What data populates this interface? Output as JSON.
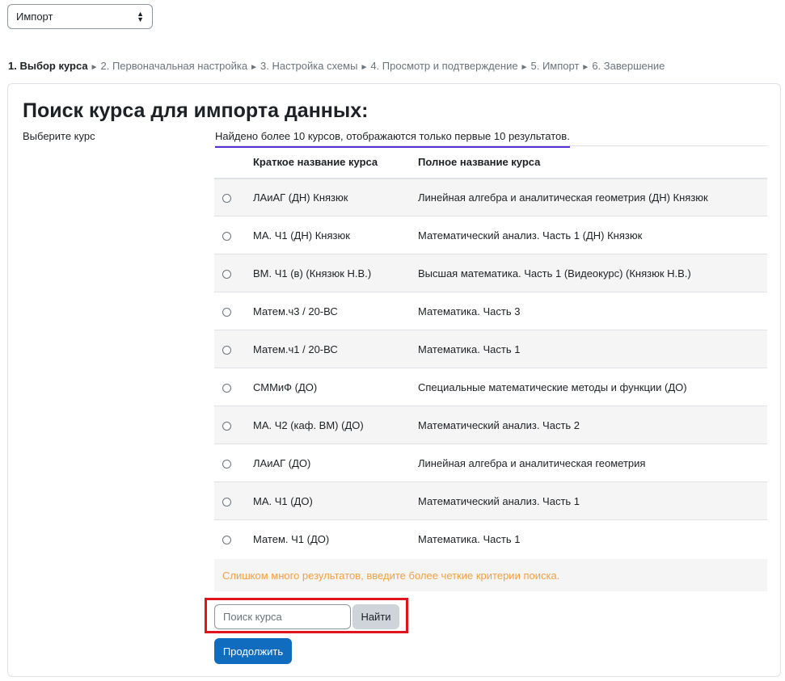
{
  "top_select": {
    "value": "Импорт"
  },
  "steps": [
    {
      "label": "1. Выбор курса",
      "current": true
    },
    {
      "label": "2. Первоначальная настройка",
      "current": false
    },
    {
      "label": "3. Настройка схемы",
      "current": false
    },
    {
      "label": "4. Просмотр и подтверждение",
      "current": false
    },
    {
      "label": "5. Импорт",
      "current": false
    },
    {
      "label": "6. Завершение",
      "current": false
    }
  ],
  "step_separator": "►",
  "panel": {
    "title": "Поиск курса для импорта данных:",
    "field_label": "Выберите курс",
    "found_note": "Найдено более 10 курсов, отображаются только первые 10 результатов.",
    "columns": {
      "short": "Краткое название курса",
      "full": "Полное название курса"
    },
    "rows": [
      {
        "short": "ЛАиАГ (ДН) Князюк",
        "full": "Линейная алгебра и аналитическая геометрия (ДН) Князюк"
      },
      {
        "short": "МА. Ч1 (ДН) Князюк",
        "full": "Математический анализ. Часть 1 (ДН) Князюк"
      },
      {
        "short": "ВМ. Ч1 (в) (Князюк Н.В.)",
        "full": "Высшая математика. Часть 1 (Видеокурс) (Князюк Н.В.)"
      },
      {
        "short": "Матем.ч3 / 20-ВС",
        "full": "Математика. Часть 3"
      },
      {
        "short": "Матем.ч1 / 20-ВС",
        "full": "Математика. Часть 1"
      },
      {
        "short": "СММиФ (ДО)",
        "full": "Специальные математические методы и функции (ДО)"
      },
      {
        "short": "МА. Ч2 (каф. ВМ) (ДО)",
        "full": "Математический анализ. Часть 2"
      },
      {
        "short": "ЛАиАГ (ДО)",
        "full": "Линейная алгебра и аналитическая геометрия"
      },
      {
        "short": "МА. Ч1 (ДО)",
        "full": "Математический анализ. Часть 1"
      },
      {
        "short": "Матем. Ч1 (ДО)",
        "full": "Математика. Часть 1"
      }
    ],
    "warning": "Слишком много результатов, введите более четкие критерии поиска.",
    "search": {
      "placeholder": "Поиск курса",
      "value": "",
      "button": "Найти"
    },
    "continue_button": "Продолжить"
  },
  "colors": {
    "primary": "#0f6cbf",
    "warning_text": "#f0a046",
    "highlight_border": "#e0141e",
    "note_underline": "#5b2fd6"
  }
}
